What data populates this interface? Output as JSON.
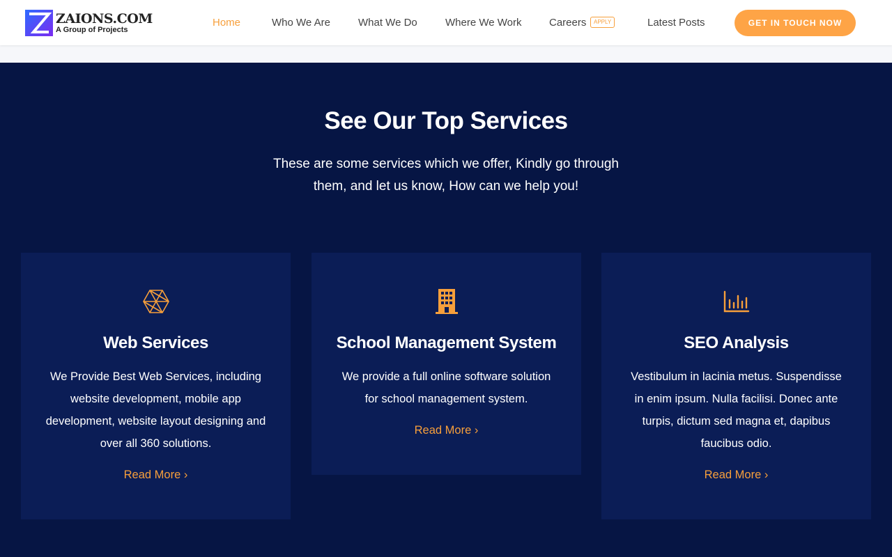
{
  "header": {
    "logo_name": "ZAIONS.COM",
    "logo_tagline": "A Group of Projects",
    "nav": [
      {
        "label": "Home"
      },
      {
        "label": "Who We Are"
      },
      {
        "label": "What We Do"
      },
      {
        "label": "Where We Work"
      },
      {
        "label": "Careers"
      },
      {
        "label": "Latest Posts"
      }
    ],
    "careers_badge": "APPLY",
    "cta_label": "GET IN TOUCH NOW"
  },
  "services": {
    "title": "See Our Top Services",
    "subtitle": "These are some services which we offer, Kindly go through them, and let us know, How can we help you!",
    "cards": [
      {
        "icon": "hexagon-network-icon",
        "title": "Web Services",
        "description": "We Provide Best Web Services, including website development, mobile app development, website layout designing and over all 360 solutions.",
        "link": "Read More ›"
      },
      {
        "icon": "building-icon",
        "title": "School Management System",
        "description": "We provide a full online software solution for school management system.",
        "link": "Read More ›"
      },
      {
        "icon": "bar-chart-icon",
        "title": "SEO Analysis",
        "description": "Vestibulum in lacinia metus. Suspendisse in enim ipsum. Nulla facilisi. Donec ante turpis, dictum sed magna et, dapibus faucibus odio.",
        "link": "Read More ›"
      }
    ]
  },
  "colors": {
    "accent": "#f79f3b",
    "cta_bg": "#fea446",
    "section_bg": "#061544",
    "card_bg": "#0b1d56"
  }
}
